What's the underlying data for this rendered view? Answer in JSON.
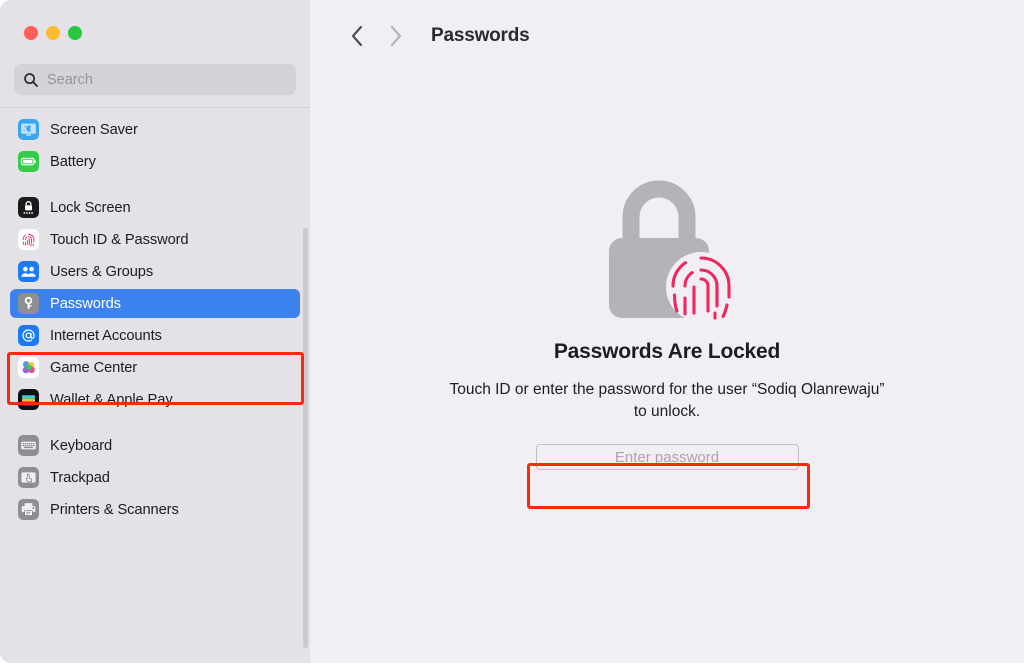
{
  "window": {
    "traffic_lights": [
      {
        "name": "close",
        "color": "#ff5f57"
      },
      {
        "name": "minimize",
        "color": "#febc2e"
      },
      {
        "name": "zoom",
        "color": "#28c840"
      }
    ]
  },
  "search": {
    "placeholder": "Search",
    "value": "",
    "icon": "search-icon"
  },
  "sidebar": {
    "items": [
      {
        "label": "Screen Saver",
        "icon": "screen-saver-icon",
        "selected": false
      },
      {
        "label": "Battery",
        "icon": "battery-icon",
        "selected": false
      },
      {
        "label": "__GAP__",
        "icon": "",
        "selected": false
      },
      {
        "label": "Lock Screen",
        "icon": "lock-screen-icon",
        "selected": false
      },
      {
        "label": "Touch ID & Password",
        "icon": "touch-id-icon",
        "selected": false
      },
      {
        "label": "Users & Groups",
        "icon": "users-groups-icon",
        "selected": false
      },
      {
        "label": "Passwords",
        "icon": "passwords-key-icon",
        "selected": true
      },
      {
        "label": "Internet Accounts",
        "icon": "internet-accounts-icon",
        "selected": false
      },
      {
        "label": "Game Center",
        "icon": "game-center-icon",
        "selected": false
      },
      {
        "label": "Wallet & Apple Pay",
        "icon": "wallet-apple-pay-icon",
        "selected": false
      },
      {
        "label": "__GAP__",
        "icon": "",
        "selected": false
      },
      {
        "label": "Keyboard",
        "icon": "keyboard-icon",
        "selected": false
      },
      {
        "label": "Trackpad",
        "icon": "trackpad-icon",
        "selected": false
      },
      {
        "label": "Printers & Scanners",
        "icon": "printers-scanners-icon",
        "selected": false
      }
    ],
    "selection_color": "#3b82ef",
    "background_color": "#e4e1e7"
  },
  "toolbar": {
    "back_label": "‹",
    "forward_label": "›",
    "title": "Passwords"
  },
  "main": {
    "graphic": "locked-padlock-fingerprint-icon",
    "heading": "Passwords Are Locked",
    "description": "Touch ID or enter the password for the user “Sodiq Olanrewaju” to unlock.",
    "password_placeholder": "Enter password",
    "password_value": "",
    "background_color": "#f2eff4"
  },
  "annotations": {
    "highlight_color": "#f62b0e",
    "boxes": [
      {
        "name": "passwords-sidebar-item-highlight"
      },
      {
        "name": "password-input-highlight"
      }
    ]
  }
}
